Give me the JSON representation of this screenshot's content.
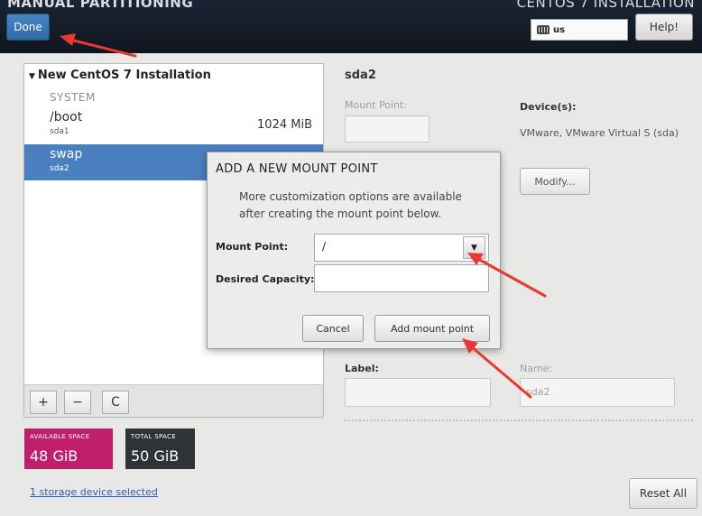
{
  "header": {
    "title": "MANUAL PARTITIONING",
    "right_title": "CENTOS 7 INSTALLATION",
    "done_label": "Done",
    "keyboard_layout": "us",
    "help_label": "Help!"
  },
  "left_panel": {
    "install_title": "New CentOS 7 Installation",
    "section_label": "SYSTEM",
    "mounts": [
      {
        "name": "/boot",
        "device": "sda1",
        "size": "1024 MiB",
        "selected": false
      },
      {
        "name": "swap",
        "device": "sda2",
        "size": "",
        "selected": true
      }
    ],
    "toolbar": {
      "add": "+",
      "remove": "−",
      "refresh": "C"
    }
  },
  "space": {
    "available_label": "AVAILABLE SPACE",
    "available_value": "48 GiB",
    "total_label": "TOTAL SPACE",
    "total_value": "50 GiB"
  },
  "storage_link": "1 storage device selected",
  "reset_label": "Reset All",
  "details": {
    "title": "sda2",
    "mount_point_label": "Mount Point:",
    "devices_label": "Device(s):",
    "device_text": "VMware, VMware Virtual S (sda)",
    "modify_label": "Modify...",
    "label_label": "Label:",
    "name_label": "Name:",
    "name_value": "sda2"
  },
  "dialog": {
    "title": "ADD A NEW MOUNT POINT",
    "description": "More customization options are available after creating the mount point below.",
    "mount_point_label": "Mount Point:",
    "mount_point_value": "/",
    "capacity_label": "Desired Capacity:",
    "cancel_label": "Cancel",
    "add_label": "Add mount point"
  },
  "colors": {
    "accent": "#4a7fc0",
    "available": "#c0206b",
    "total": "#2e3436",
    "annotation": "#e8382f"
  }
}
